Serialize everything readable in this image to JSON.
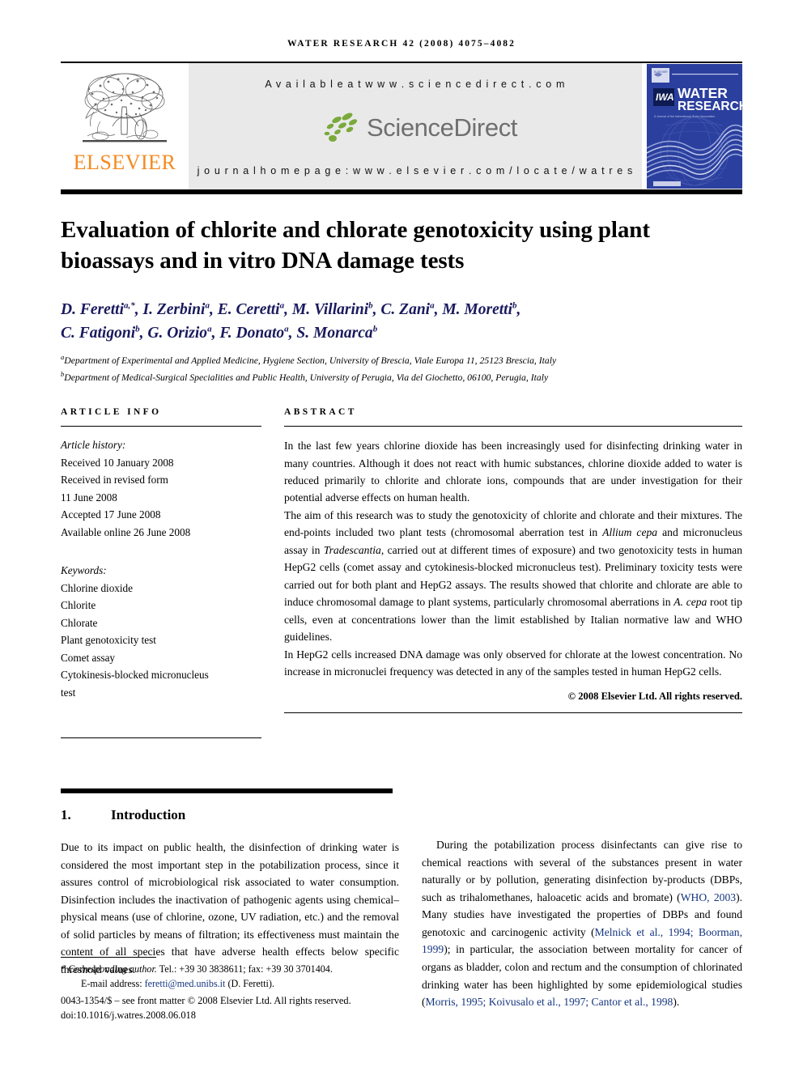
{
  "running_head": "Water Research 42 (2008) 4075–4082",
  "masthead": {
    "elsevier_wordmark": "ELSEVIER",
    "available_at": "A v a i l a b l e   a t   w w w . s c i e n c e d i r e c t . c o m",
    "sciencedirect_word": "ScienceDirect",
    "journal_homepage": "j o u r n a l   h o m e p a g e :   w w w . e l s e v i e r . c o m / l o c a t e / w a t r e s",
    "cover": {
      "title_line1": "WATER",
      "title_line2": "RESEARCH",
      "association_line": "A Journal of the International Water Association",
      "iwa_logo_text": "IWA",
      "background_color": "#2b3f9e"
    }
  },
  "article": {
    "title": "Evaluation of chlorite and chlorate genotoxicity using plant bioassays and in vitro DNA damage tests",
    "authors_line1": "D. Feretti<sup>a,*</sup>, I. Zerbini<sup>a</sup>, E. Ceretti<sup>a</sup>, M. Villarini<sup>b</sup>, C. Zani<sup>a</sup>, M. Moretti<sup>b</sup>,",
    "authors_line2": "C. Fatigoni<sup>b</sup>, G. Orizio<sup>a</sup>, F. Donato<sup>a</sup>, S. Monarca<sup>b</sup>",
    "affiliation_a": "<sup>a</sup>Department of Experimental and Applied Medicine, Hygiene Section, University of Brescia, Viale Europa 11, 25123 Brescia, Italy",
    "affiliation_b": "<sup>b</sup>Department of Medical-Surgical Specialities and Public Health, University of Perugia, Via del Giochetto, 06100, Perugia, Italy"
  },
  "article_info": {
    "heading": "ARTICLE INFO",
    "history_label": "Article history:",
    "history": [
      "Received 10 January 2008",
      "Received in revised form",
      "11 June 2008",
      "Accepted 17 June 2008",
      "Available online 26 June 2008"
    ],
    "keywords_label": "Keywords:",
    "keywords": [
      "Chlorine dioxide",
      "Chlorite",
      "Chlorate",
      "Plant genotoxicity test",
      "Comet assay",
      "Cytokinesis-blocked    micronucleus",
      "test"
    ]
  },
  "abstract": {
    "heading": "ABSTRACT",
    "paragraph_1": "In the last few years chlorine dioxide has been increasingly used for disinfecting drinking water in many countries. Although it does not react with humic substances, chlorine dioxide added to water is reduced primarily to chlorite and chlorate ions, compounds that are under investigation for their potential adverse effects on human health.",
    "paragraph_2": "The aim of this research was to study the genotoxicity of chlorite and chlorate and their mixtures. The end-points included two plant tests (chromosomal aberration test in <i>Allium cepa</i> and micronucleus assay in <i>Tradescantia</i>, carried out at different times of exposure) and two genotoxicity tests in human HepG2 cells (comet assay and cytokinesis-blocked micronucleus test). Preliminary toxicity tests were carried out for both plant and HepG2 assays. The results showed that chlorite and chlorate are able to induce chromosomal damage to plant systems, particularly chromosomal aberrations in <i>A. cepa</i> root tip cells, even at concentrations lower than the limit established by Italian normative law and WHO guidelines.",
    "paragraph_3": "In HepG2 cells increased DNA damage was only observed for chlorate at the lowest concentration. No increase in micronuclei frequency was detected in any of the samples tested in human HepG2 cells.",
    "copyright": "© 2008 Elsevier Ltd. All rights reserved."
  },
  "introduction": {
    "number": "1.",
    "heading": "Introduction",
    "left_paragraph": "Due to its impact on public health, the disinfection of drinking water is considered the most important step in the potabilization process, since it assures control of microbiological risk associated to water consumption. Disinfection includes the inactivation of pathogenic agents using chemical–physical means (use of chlorine, ozone, UV radiation, etc.) and the removal of solid particles by means of filtration; its effectiveness must maintain the content of all species that have adverse health effects below specific threshold values.",
    "right_paragraph_part1": "During the potabilization process disinfectants can give rise to chemical reactions with several of the substances present in water naturally or by pollution, generating disinfection by-products (DBPs, such as trihalomethanes, haloacetic acids and bromate) (",
    "citation_1": "WHO, 2003",
    "right_paragraph_part2": "). Many studies have investigated the properties of DBPs and found genotoxic and carcinogenic activity (",
    "citation_2": "Melnick et al., 1994; Boorman, 1999",
    "right_paragraph_part3": "); in particular, the association between mortality for cancer of organs as bladder, colon and rectum and the consumption of chlorinated drinking water has been highlighted by some epidemiological studies (",
    "citation_3": "Morris, 1995; Koivusalo et al., 1997; Cantor et al., 1998",
    "right_paragraph_part4": ")."
  },
  "footnotes": {
    "corresponding_marker": "*",
    "corresponding_label": "Corresponding author.",
    "corresponding_contact": "Tel.: +39 30 3838611; fax: +39 30 3701404.",
    "email_label": "E-mail address:",
    "email": "feretti@med.unibs.it",
    "email_owner": "(D. Feretti).",
    "front_matter": "0043-1354/$ – see front matter © 2008 Elsevier Ltd. All rights reserved.",
    "doi": "doi:10.1016/j.watres.2008.06.018"
  },
  "colors": {
    "elsevier_orange": "#F6891F",
    "author_navy": "#1a1a5e",
    "citation_blue": "#15357f",
    "cover_blue": "#2b3f9e",
    "sciencedirect_green": "#7aa93c",
    "banner_grey": "#e9e9e9"
  }
}
